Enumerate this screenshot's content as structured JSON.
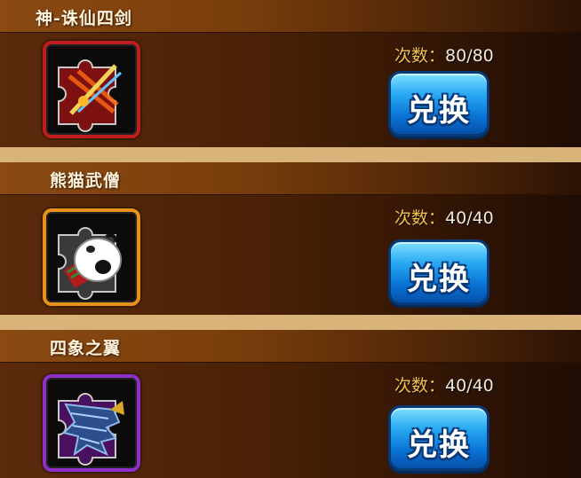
{
  "items": [
    {
      "title": "神-诛仙四剑",
      "count_label": "次数：",
      "count_value": "80/80",
      "button_label": "兑换",
      "frame_color": "#c01e1e",
      "icon": "sword-puzzle-icon"
    },
    {
      "title": "熊猫武僧",
      "count_label": "次数：",
      "count_value": "40/40",
      "button_label": "兑换",
      "frame_color": "#e8911a",
      "icon": "panda-puzzle-icon"
    },
    {
      "title": "四象之翼",
      "count_label": "次数：",
      "count_value": "40/40",
      "button_label": "兑换",
      "frame_color": "#8e2fc8",
      "icon": "wing-puzzle-icon"
    }
  ]
}
